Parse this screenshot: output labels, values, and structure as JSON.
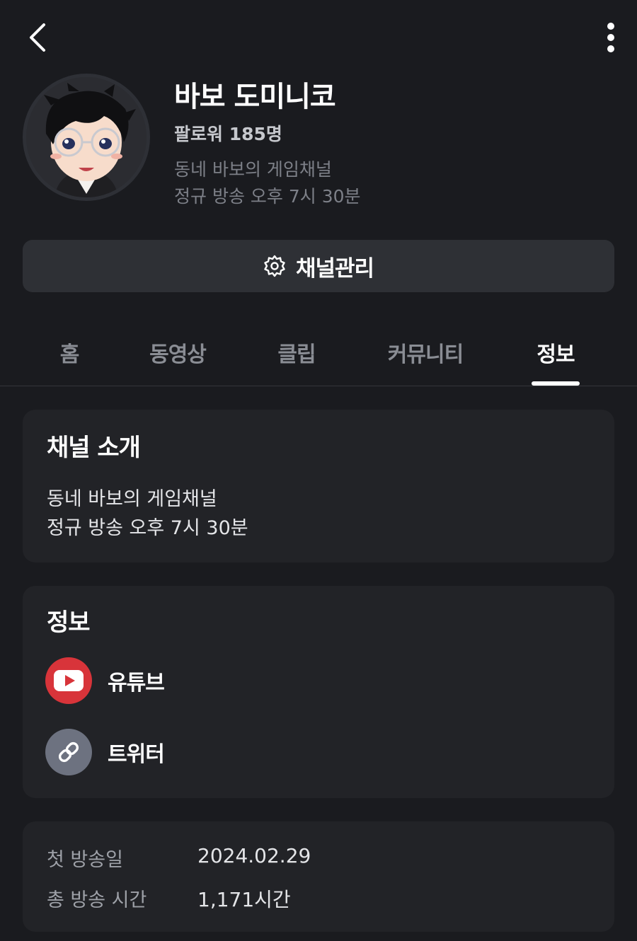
{
  "topbar": {
    "back_icon": "chevron-left-icon",
    "more_icon": "more-vertical-icon"
  },
  "profile": {
    "name": "바보 도미니코",
    "followers": "팔로워 185명",
    "description_lines": [
      "동네 바보의 게임채널",
      "정규 방송 오후 7시 30분"
    ]
  },
  "manage_button": {
    "icon": "gear-icon",
    "label": "채널관리"
  },
  "tabs": [
    {
      "label": "홈",
      "active": false
    },
    {
      "label": "동영상",
      "active": false
    },
    {
      "label": "클립",
      "active": false
    },
    {
      "label": "커뮤니티",
      "active": false
    },
    {
      "label": "정보",
      "active": true
    }
  ],
  "intro_card": {
    "title": "채널 소개",
    "lines": [
      "동네 바보의 게임채널",
      "정규 방송 오후 7시 30분"
    ]
  },
  "info_card": {
    "title": "정보",
    "links": [
      {
        "icon": "youtube-icon",
        "label": "유튜브",
        "color": "#d8343a"
      },
      {
        "icon": "link-icon",
        "label": "트위터",
        "color": "#6d7280"
      }
    ]
  },
  "stats_card": {
    "rows": [
      {
        "label": "첫 방송일",
        "value": "2024.02.29"
      },
      {
        "label": "총 방송 시간",
        "value": "1,171시간"
      }
    ]
  },
  "colors": {
    "background": "#1a1b1f",
    "card": "#222327",
    "button": "#2e3035",
    "muted_text": "#7d8088"
  }
}
